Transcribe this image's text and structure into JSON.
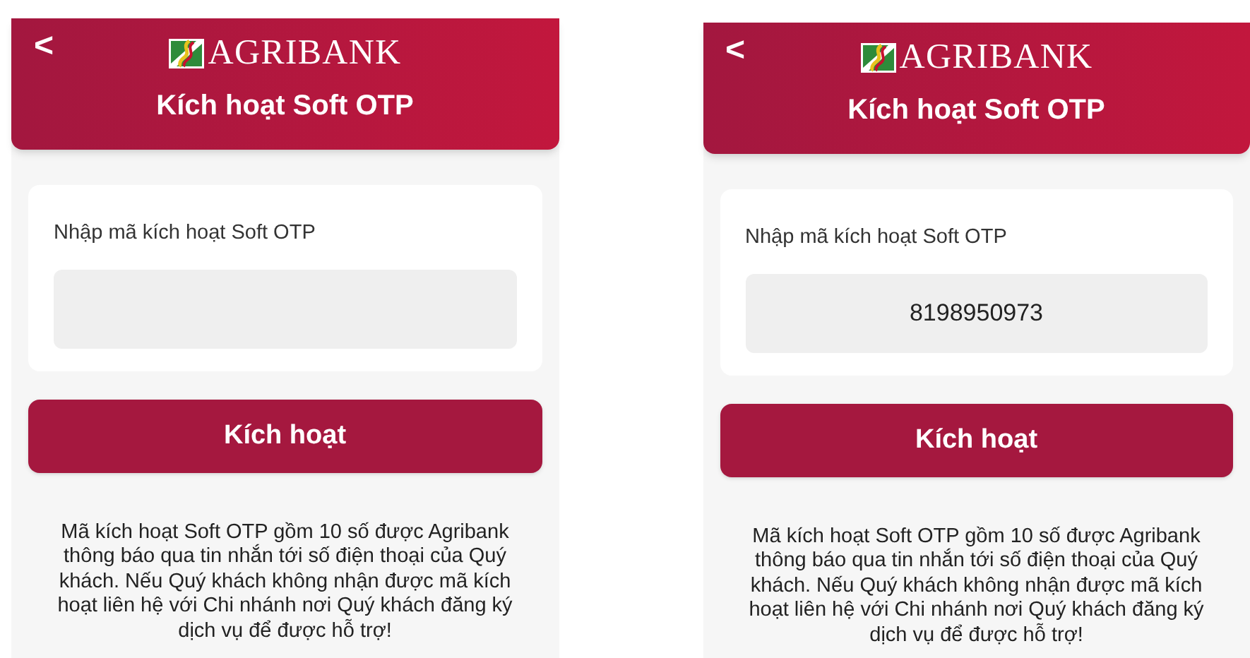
{
  "screens": [
    {
      "header": {
        "back": "<",
        "brand": "AGRIBANK",
        "title": "Kích hoạt Soft OTP"
      },
      "field": {
        "label": "Nhập mã kích hoạt Soft OTP"
      },
      "button": "Kích hoạt",
      "note": "Mã kích hoạt Soft OTP gồm 10 số được Agribank thông báo qua tin nhắn tới số điện thoại của Quý khách. Nếu Quý khách không nhận được mã kích hoạt liên hệ với Chi nhánh nơi Quý khách đăng ký dịch vụ để được hỗ trợ!"
    },
    {
      "header": {
        "back": "<",
        "brand": "AGRIBANK",
        "title": "Kích hoạt Soft OTP"
      },
      "field": {
        "label": "Nhập mã kích hoạt Soft OTP",
        "value": "8198950973"
      },
      "button": "Kích hoạt",
      "note": "Mã kích hoạt Soft OTP gồm 10 số được Agribank thông báo qua tin nhắn tới số điện thoại của Quý khách. Nếu Quý khách không nhận được mã kích hoạt liên hệ với Chi nhánh nơi Quý khách đăng ký dịch vụ để được hỗ trợ!"
    }
  ]
}
